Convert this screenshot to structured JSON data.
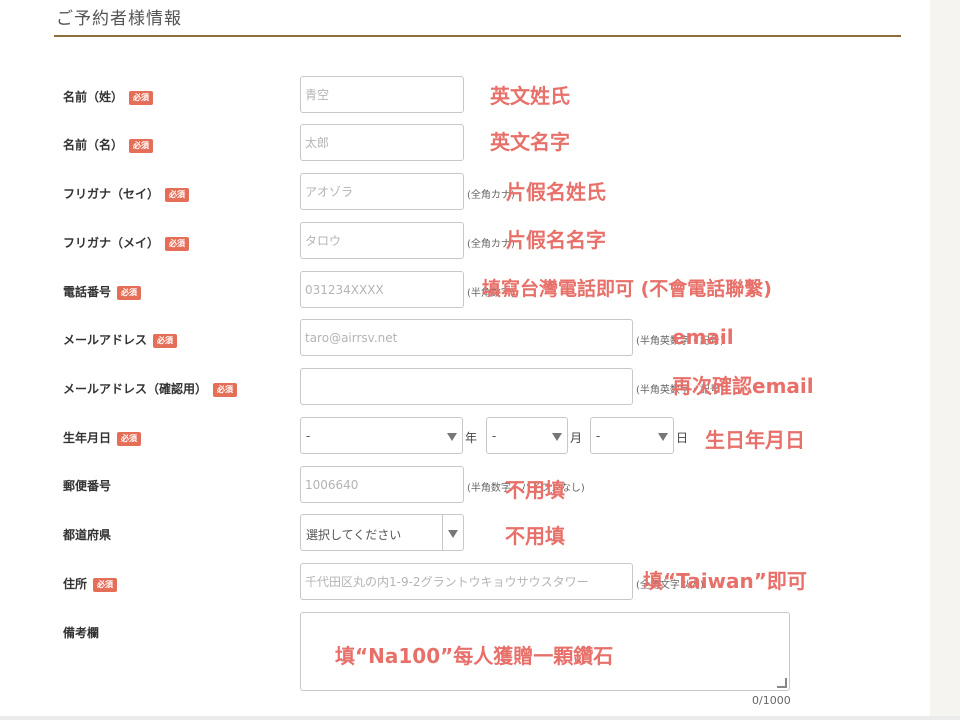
{
  "section": {
    "title": "ご予約者様情報"
  },
  "required_badge": "必須",
  "fields": {
    "last_name": {
      "label": "名前（姓）",
      "placeholder": "青空",
      "note": "英文姓氏"
    },
    "first_name": {
      "label": "名前（名）",
      "placeholder": "太郎",
      "note": "英文名字"
    },
    "kana_last": {
      "label": "フリガナ（セイ）",
      "placeholder": "アオゾラ",
      "hint": "(全角カナ)",
      "note": "片假名姓氏"
    },
    "kana_first": {
      "label": "フリガナ（メイ）",
      "placeholder": "タロウ",
      "hint": "(全角カナ)",
      "note": "片假名名字"
    },
    "phone": {
      "label": "電話番号",
      "placeholder": "031234XXXX",
      "hint": "(半角数字)",
      "note": "填寫台灣電話即可 (不會電話聯繫)"
    },
    "email": {
      "label": "メールアドレス",
      "placeholder": "taro@airrsv.net",
      "hint": "(半角英数字・記号)",
      "note": "email"
    },
    "email_confirm": {
      "label": "メールアドレス（確認用）",
      "placeholder": "",
      "hint": "(半角英数字・記号)",
      "note": "再次確認email"
    },
    "birthday": {
      "label": "生年月日",
      "year": "-",
      "month": "-",
      "day": "-",
      "unit_year": "年",
      "unit_month": "月",
      "unit_day": "日",
      "note": "生日年月日"
    },
    "postal": {
      "label": "郵便番号",
      "placeholder": "1006640",
      "hint": "(半角数字・ハイフンなし)",
      "note": "不用填"
    },
    "prefecture": {
      "label": "都道府県",
      "value": "選択してください",
      "note": "不用填"
    },
    "address": {
      "label": "住所",
      "placeholder": "千代田区丸の内1-9-2グラントウキョウサウスタワー",
      "hint": "(全角文字以内)",
      "note": "填“Taiwan”即可"
    },
    "remarks": {
      "label": "備考欄",
      "counter": "0/1000",
      "note": "填“Na100”每人獲贈一顆鑽石"
    }
  }
}
